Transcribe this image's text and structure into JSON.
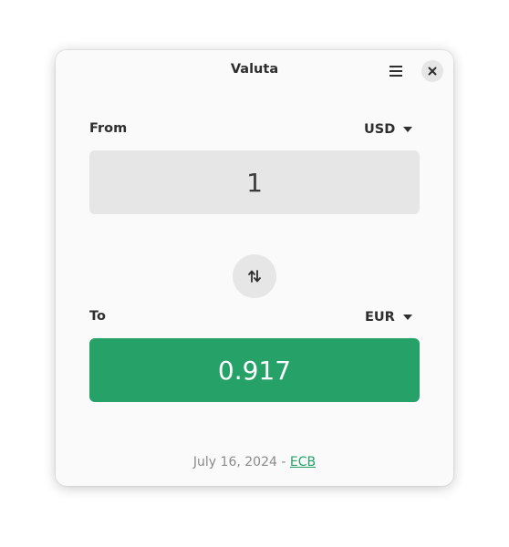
{
  "window": {
    "title": "Valuta"
  },
  "from": {
    "label": "From",
    "currency": "USD",
    "amount": "1"
  },
  "to": {
    "label": "To",
    "currency": "EUR",
    "amount": "0.917"
  },
  "footer": {
    "date_text": "July 16, 2024 - ",
    "source_link": "ECB"
  },
  "icons": {
    "menu": "hamburger-menu-icon",
    "close": "close-icon",
    "swap": "swap-arrows-icon",
    "dropdown": "chevron-down-icon"
  },
  "colors": {
    "accent": "#26a269",
    "window_bg": "#fafafa",
    "field_bg": "#e6e6e6"
  }
}
